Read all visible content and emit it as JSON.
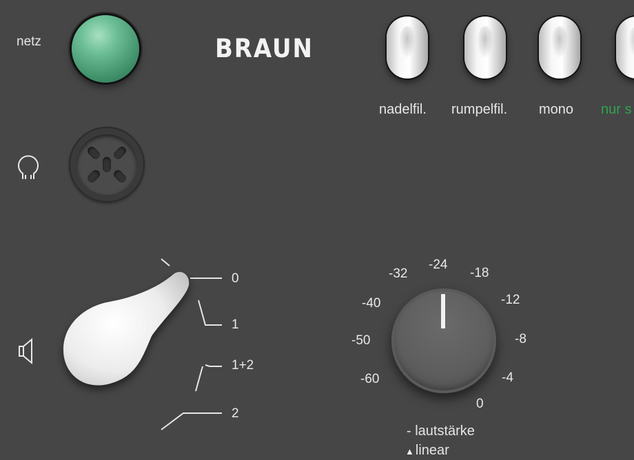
{
  "power": {
    "label": "netz",
    "state": "on",
    "color": "#5fb58b"
  },
  "brand": "BRAUN",
  "switches": [
    {
      "label": "nadelfil.",
      "color": "#e6e6e6"
    },
    {
      "label": "rumpelfil.",
      "color": "#e6e6e6"
    },
    {
      "label": "mono",
      "color": "#e6e6e6"
    },
    {
      "label": "nur s",
      "color": "#2ea44f"
    }
  ],
  "headphone": {
    "icon": "headphone-icon"
  },
  "selector": {
    "icon": "speaker-icon",
    "positions": [
      "0",
      "1",
      "1+2",
      "2"
    ],
    "selected": "0"
  },
  "volume": {
    "scale": [
      "-60",
      "-50",
      "-40",
      "-32",
      "-24",
      "-18",
      "-12",
      "-8",
      "-4",
      "0"
    ],
    "pointer": "-24",
    "label": "- lautstärke",
    "linear_label": "linear"
  }
}
